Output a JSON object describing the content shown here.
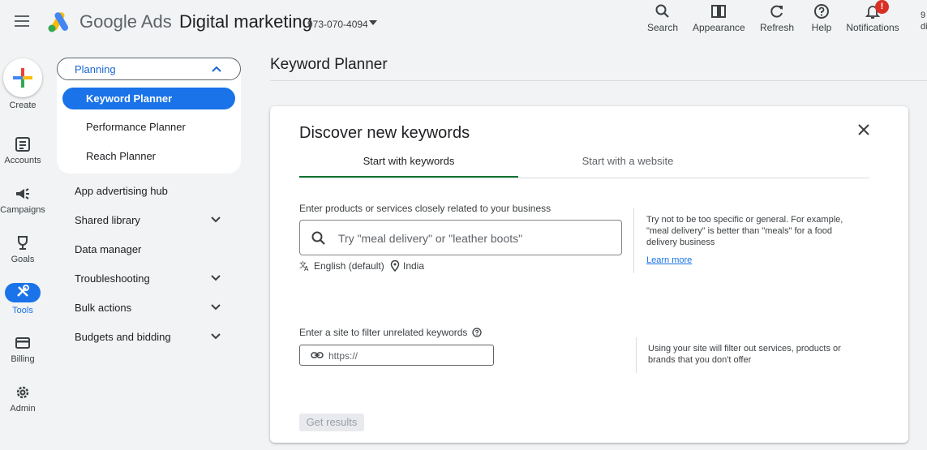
{
  "header": {
    "brand": "Google Ads",
    "account_name": "Digital marketing",
    "account_id": "973-070-4094",
    "buttons": [
      {
        "label": "Search",
        "icon": "search-icon"
      },
      {
        "label": "Appearance",
        "icon": "appearance-icon"
      },
      {
        "label": "Refresh",
        "icon": "refresh-icon"
      },
      {
        "label": "Help",
        "icon": "help-icon"
      },
      {
        "label": "Notifications",
        "icon": "bell-icon",
        "badge": "!"
      }
    ],
    "overflow_text_1": "9",
    "overflow_text_2": "di"
  },
  "rail": {
    "items": [
      {
        "label": "Create",
        "icon": "plus-icon"
      },
      {
        "label": "Accounts",
        "icon": "accounts-icon"
      },
      {
        "label": "Campaigns",
        "icon": "megaphone-icon"
      },
      {
        "label": "Goals",
        "icon": "trophy-icon"
      },
      {
        "label": "Tools",
        "icon": "tools-icon",
        "active": true
      },
      {
        "label": "Billing",
        "icon": "credit-card-icon"
      },
      {
        "label": "Admin",
        "icon": "gear-icon"
      }
    ]
  },
  "nav": {
    "planning": {
      "label": "Planning",
      "items": [
        {
          "label": "Keyword Planner",
          "active": true
        },
        {
          "label": "Performance Planner"
        },
        {
          "label": "Reach Planner"
        }
      ]
    },
    "items": [
      {
        "label": "App advertising hub",
        "expandable": false
      },
      {
        "label": "Shared library",
        "expandable": true
      },
      {
        "label": "Data manager",
        "expandable": false
      },
      {
        "label": "Troubleshooting",
        "expandable": true
      },
      {
        "label": "Bulk actions",
        "expandable": true
      },
      {
        "label": "Budgets and bidding",
        "expandable": true
      }
    ]
  },
  "main": {
    "page_title": "Keyword Planner",
    "card": {
      "title": "Discover new keywords",
      "tabs": [
        {
          "label": "Start with keywords",
          "active": true
        },
        {
          "label": "Start with a website",
          "active": false
        }
      ],
      "keywords_label": "Enter products or services closely related to your business",
      "keywords_placeholder": "Try \"meal delivery\" or \"leather boots\"",
      "language": "English (default)",
      "location": "India",
      "keywords_help": "Try not to be too specific or general. For example, \"meal delivery\" is better than \"meals\" for a food delivery business",
      "learn_more": "Learn more",
      "site_label": "Enter a site to filter unrelated keywords",
      "site_placeholder": "https://",
      "site_help": "Using your site will filter out services, products or brands that you don't offer",
      "submit_label": "Get results"
    }
  },
  "colors": {
    "accent": "#1a73e8",
    "tab_underline": "#137333",
    "badge": "#d93025",
    "background": "#f1f3f4"
  }
}
